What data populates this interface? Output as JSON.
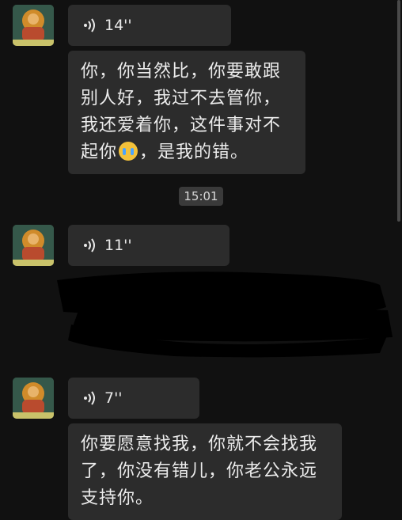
{
  "messages": {
    "msg1": {
      "voice_duration": "14''",
      "text_before_emoji": "你，你当然比，你要敢跟别人好，我过不去管你，我还爱着你，这件事对不起你",
      "emoji": "loudly-crying-face",
      "text_after_emoji": "，是我的错。"
    },
    "timestamp": "15:01",
    "msg2": {
      "voice_duration": "11''"
    },
    "msg3": {
      "voice_duration": "7''",
      "text": "你要愿意找我，你就不会找我了，你没有错儿，你老公永远支持你。"
    }
  },
  "colors": {
    "background": "#111111",
    "bubble": "#2c2c2c",
    "text": "#ececec",
    "timestamp_bg": "#3a3a3a",
    "redaction": "#000000"
  },
  "icons": {
    "avatar": "buddha-thangka-avatar",
    "voice": "voice-wave-icon",
    "emoji": "loudly-crying-face-icon"
  }
}
